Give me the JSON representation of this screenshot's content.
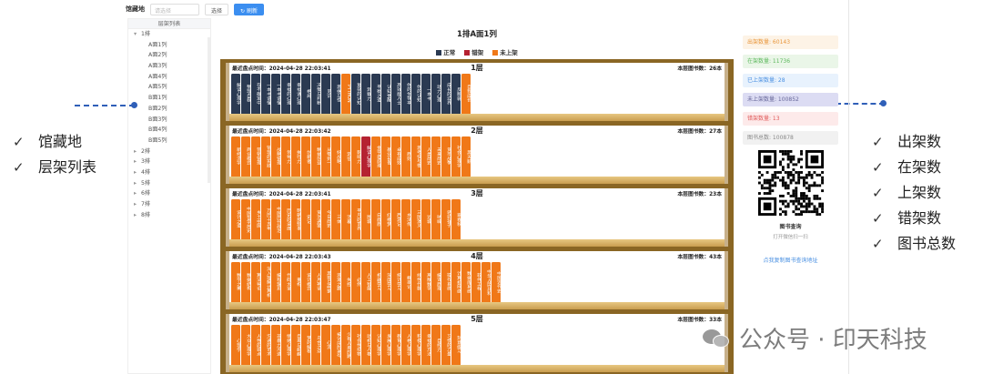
{
  "annotations": {
    "left": [
      "馆藏地",
      "层架列表"
    ],
    "right": [
      "出架数",
      "在架数",
      "上架数",
      "错架数",
      "图书总数"
    ],
    "check": "✓"
  },
  "toolbar": {
    "location_label": "馆藏地",
    "location_placeholder": "请选择",
    "select_button": "选择",
    "refresh_button": "↻ 刷新"
  },
  "tree": {
    "header": "层架列表",
    "items": [
      {
        "label": "1排",
        "level": 1,
        "expanded": true
      },
      {
        "label": "A面1列",
        "level": 2
      },
      {
        "label": "A面2列",
        "level": 2
      },
      {
        "label": "A面3列",
        "level": 2
      },
      {
        "label": "A面4列",
        "level": 2
      },
      {
        "label": "A面5列",
        "level": 2
      },
      {
        "label": "B面1列",
        "level": 2
      },
      {
        "label": "B面2列",
        "level": 2
      },
      {
        "label": "B面3列",
        "level": 2
      },
      {
        "label": "B面4列",
        "level": 2
      },
      {
        "label": "B面5列",
        "level": 2
      },
      {
        "label": "2排",
        "level": 1
      },
      {
        "label": "3排",
        "level": 1
      },
      {
        "label": "4排",
        "level": 1
      },
      {
        "label": "5排",
        "level": 1
      },
      {
        "label": "6排",
        "level": 1
      },
      {
        "label": "7排",
        "level": 1
      },
      {
        "label": "8排",
        "level": 1
      }
    ]
  },
  "main": {
    "title": "1排A面1列",
    "legend": [
      {
        "label": "正常",
        "color": "#2b3a52"
      },
      {
        "label": "错架",
        "color": "#b52231"
      },
      {
        "label": "未上架",
        "color": "#f07818"
      }
    ]
  },
  "shelves": [
    {
      "inventory_time": "最近盘点时间：2024-04-28 22:03:41",
      "layer": "1层",
      "count": "本层图书数：26本",
      "books": [
        {
          "t": "解读心理学",
          "s": "normal"
        },
        {
          "t": "整理自我",
          "s": "normal"
        },
        {
          "t": "在不确定中",
          "s": "normal"
        },
        {
          "t": "一本书读懂",
          "s": "normal"
        },
        {
          "t": "一本书读懂",
          "s": "normal"
        },
        {
          "t": "幸福的心理",
          "s": "normal"
        },
        {
          "t": "幸福课心理",
          "s": "normal"
        },
        {
          "t": "格局",
          "s": "normal"
        },
        {
          "t": "决策与判断",
          "s": "normal"
        },
        {
          "t": "见识",
          "s": "normal"
        },
        {
          "t": "思维与性",
          "s": "normal"
        },
        {
          "t": "PYTHON",
          "s": "unshelved"
        },
        {
          "t": "复杂的认知",
          "s": "normal"
        },
        {
          "t": "洞察力",
          "s": "normal"
        },
        {
          "t": "平衡之道",
          "s": "normal"
        },
        {
          "t": "认知觉醒",
          "s": "normal"
        },
        {
          "t": "高效能人士",
          "s": "normal"
        },
        {
          "t": "你的生存本",
          "s": "normal"
        },
        {
          "t": "你的认知",
          "s": "normal"
        },
        {
          "t": "一本书",
          "s": "normal"
        },
        {
          "t": "动力心理",
          "s": "normal"
        },
        {
          "t": "成长的边界",
          "s": "normal"
        },
        {
          "t": "反脆弱",
          "s": "normal"
        },
        {
          "t": "自我成长",
          "s": "unshelved"
        }
      ]
    },
    {
      "inventory_time": "最近盘点时间：2024-04-28 22:03:42",
      "layer": "2层",
      "count": "本层图书数：27本",
      "books": [
        {
          "t": "新经济学",
          "s": "unshelved"
        },
        {
          "t": "商业模式",
          "s": "unshelved"
        },
        {
          "t": "营销管理",
          "s": "unshelved"
        },
        {
          "t": "管理的实践",
          "s": "unshelved"
        },
        {
          "t": "战略管理",
          "s": "unshelved"
        },
        {
          "t": "领导力",
          "s": "unshelved"
        },
        {
          "t": "执行力",
          "s": "unshelved"
        },
        {
          "t": "创新者",
          "s": "unshelved"
        },
        {
          "t": "精益创业",
          "s": "unshelved"
        },
        {
          "t": "从零到一",
          "s": "unshelved"
        },
        {
          "t": "好战略",
          "s": "unshelved"
        },
        {
          "t": "定位",
          "s": "unshelved"
        },
        {
          "t": "影响力",
          "s": "unshelved"
        },
        {
          "t": "解读心理学",
          "s": "wrong"
        },
        {
          "t": "金字塔原理",
          "s": "unshelved"
        },
        {
          "t": "基业长青",
          "s": "unshelved"
        },
        {
          "t": "卓有成效",
          "s": "unshelved"
        },
        {
          "t": "原则",
          "s": "unshelved"
        },
        {
          "t": "思考快与慢",
          "s": "unshelved"
        },
        {
          "t": "人类简史",
          "s": "unshelved"
        },
        {
          "t": "未来简史",
          "s": "unshelved"
        },
        {
          "t": "货币战争",
          "s": "unshelved"
        },
        {
          "t": "社会心理学",
          "s": "unshelved"
        },
        {
          "t": "黑天鹅",
          "s": "unshelved"
        }
      ]
    },
    {
      "inventory_time": "最近盘点时间：2024-04-28 22:03:41",
      "layer": "3层",
      "count": "本层图书数：23本",
      "books": [
        {
          "t": "设计之道",
          "s": "unshelved"
        },
        {
          "t": "中国哲学简史",
          "s": "unshelved"
        },
        {
          "t": "乡土中国",
          "s": "unshelved"
        },
        {
          "t": "万历十五年",
          "s": "unshelved"
        },
        {
          "t": "中国历代政治",
          "s": "unshelved"
        },
        {
          "t": "历史的温度",
          "s": "unshelved"
        },
        {
          "t": "明朝那些事",
          "s": "unshelved"
        },
        {
          "t": "史记",
          "s": "unshelved"
        },
        {
          "t": "资治通鉴",
          "s": "unshelved"
        },
        {
          "t": "今日简史",
          "s": "unshelved"
        },
        {
          "t": "三体",
          "s": "unshelved"
        },
        {
          "t": "活着",
          "s": "unshelved"
        },
        {
          "t": "平凡的世界",
          "s": "unshelved"
        },
        {
          "t": "围城",
          "s": "unshelved"
        },
        {
          "t": "白鹿原",
          "s": "unshelved"
        },
        {
          "t": "红楼梦",
          "s": "unshelved"
        },
        {
          "t": "西游记",
          "s": "unshelved"
        },
        {
          "t": "水浒传",
          "s": "unshelved"
        },
        {
          "t": "三国演义",
          "s": "unshelved"
        },
        {
          "t": "边城",
          "s": "unshelved"
        },
        {
          "t": "呐喊",
          "s": "unshelved"
        },
        {
          "t": "骆驼祥子",
          "s": "unshelved"
        },
        {
          "t": "家春秋",
          "s": "unshelved"
        }
      ]
    },
    {
      "inventory_time": "最近盘点时间：2024-04-28 22:03:43",
      "layer": "4层",
      "count": "本层图书数：43本",
      "books": [
        {
          "t": "数学之美",
          "s": "unshelved"
        },
        {
          "t": "数据结构",
          "s": "unshelved"
        },
        {
          "t": "算法导论",
          "s": "unshelved"
        },
        {
          "t": "深入理解计算机",
          "s": "unshelved"
        },
        {
          "t": "编程珠玑",
          "s": "unshelved"
        },
        {
          "t": "代码大全",
          "s": "unshelved"
        },
        {
          "t": "重构",
          "s": "unshelved"
        },
        {
          "t": "设计模式",
          "s": "unshelved"
        },
        {
          "t": "人月神话",
          "s": "unshelved"
        },
        {
          "t": "黑客与画家",
          "s": "unshelved"
        },
        {
          "t": "浪潮之巅",
          "s": "unshelved"
        },
        {
          "t": "失控",
          "s": "unshelved"
        },
        {
          "t": "必然",
          "s": "unshelved"
        },
        {
          "t": "人工智能",
          "s": "unshelved"
        },
        {
          "t": "机器学习",
          "s": "unshelved"
        },
        {
          "t": "深度学习",
          "s": "unshelved"
        },
        {
          "t": "统计学习",
          "s": "unshelved"
        },
        {
          "t": "概率论",
          "s": "unshelved"
        },
        {
          "t": "线性代数",
          "s": "unshelved"
        },
        {
          "t": "离散数学",
          "s": "unshelved"
        },
        {
          "t": "编译原理",
          "s": "unshelved"
        },
        {
          "t": "操作系统",
          "s": "unshelved"
        },
        {
          "t": "计算机网络",
          "s": "unshelved"
        },
        {
          "t": "数据库系统",
          "s": "unshelved"
        },
        {
          "t": "软件工程",
          "s": "unshelved"
        },
        {
          "t": "中华人民共和",
          "s": "unshelved"
        },
        {
          "t": "中国近代史",
          "s": "unshelved"
        }
      ]
    },
    {
      "inventory_time": "最近盘点时间：2024-04-28 22:03:47",
      "layer": "5层",
      "count": "本层图书数：33本",
      "books": [
        {
          "t": "心理学",
          "s": "unshelved"
        },
        {
          "t": "大众心理学",
          "s": "unshelved"
        },
        {
          "t": "人性的弱点",
          "s": "unshelved"
        },
        {
          "t": "沟通的艺术",
          "s": "unshelved"
        },
        {
          "t": "非暴力沟通",
          "s": "unshelved"
        },
        {
          "t": "情绪心理学",
          "s": "unshelved"
        },
        {
          "t": "自卑与超越",
          "s": "unshelved"
        },
        {
          "t": "梦的解析",
          "s": "unshelved"
        },
        {
          "t": "乌合之众",
          "s": "unshelved"
        },
        {
          "t": "心流",
          "s": "unshelved"
        },
        {
          "t": "被讨厌的勇气",
          "s": "unshelved"
        },
        {
          "t": "少有人走的路",
          "s": "unshelved"
        },
        {
          "t": "社会性动物",
          "s": "unshelved"
        },
        {
          "t": "动机与人格",
          "s": "unshelved"
        },
        {
          "t": "认知心理学",
          "s": "unshelved"
        },
        {
          "t": "发展心理学",
          "s": "unshelved"
        },
        {
          "t": "教育心理学",
          "s": "unshelved"
        },
        {
          "t": "人格心理学",
          "s": "unshelved"
        },
        {
          "t": "积极心理学",
          "s": "unshelved"
        },
        {
          "t": "幸福的方法",
          "s": "unshelved"
        },
        {
          "t": "自控力",
          "s": "unshelved"
        },
        {
          "t": "习惯的力量",
          "s": "unshelved"
        },
        {
          "t": "刻意练习",
          "s": "unshelved"
        }
      ]
    }
  ],
  "stats": [
    {
      "label": "出架数量: 60143",
      "bg": "#fdf3e6",
      "fg": "#e8963a"
    },
    {
      "label": "在架数量: 11736",
      "bg": "#eaf6e8",
      "fg": "#5cb85c"
    },
    {
      "label": "已上架数量: 28",
      "bg": "#e8f2fd",
      "fg": "#4a90e2"
    },
    {
      "label": "未上架数量: 100852",
      "bg": "#dcdcf3",
      "fg": "#666699"
    },
    {
      "label": "错架数量: 13",
      "bg": "#fdeaea",
      "fg": "#e05a5a"
    },
    {
      "label": "图书总数: 100878",
      "bg": "#f1f1f1",
      "fg": "#888888"
    }
  ],
  "qr": {
    "title": "图书查询",
    "subtitle": "打开微信扫一扫",
    "link": "点我复制图书查询地址"
  },
  "watermark": "公众号 · 印天科技"
}
